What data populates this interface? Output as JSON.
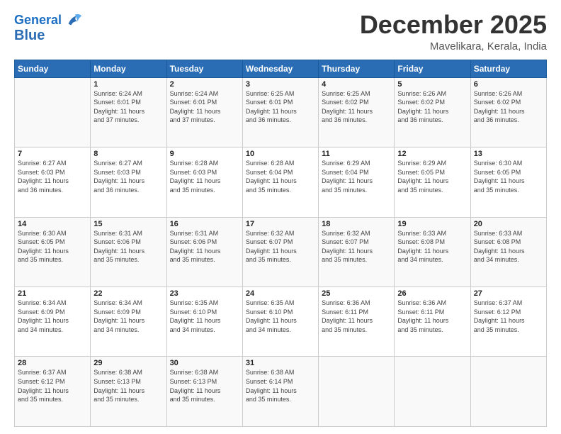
{
  "header": {
    "logo_line1": "General",
    "logo_line2": "Blue",
    "month_title": "December 2025",
    "location": "Mavelikara, Kerala, India"
  },
  "days_of_week": [
    "Sunday",
    "Monday",
    "Tuesday",
    "Wednesday",
    "Thursday",
    "Friday",
    "Saturday"
  ],
  "weeks": [
    [
      {
        "day": "",
        "info": ""
      },
      {
        "day": "1",
        "info": "Sunrise: 6:24 AM\nSunset: 6:01 PM\nDaylight: 11 hours\nand 37 minutes."
      },
      {
        "day": "2",
        "info": "Sunrise: 6:24 AM\nSunset: 6:01 PM\nDaylight: 11 hours\nand 37 minutes."
      },
      {
        "day": "3",
        "info": "Sunrise: 6:25 AM\nSunset: 6:01 PM\nDaylight: 11 hours\nand 36 minutes."
      },
      {
        "day": "4",
        "info": "Sunrise: 6:25 AM\nSunset: 6:02 PM\nDaylight: 11 hours\nand 36 minutes."
      },
      {
        "day": "5",
        "info": "Sunrise: 6:26 AM\nSunset: 6:02 PM\nDaylight: 11 hours\nand 36 minutes."
      },
      {
        "day": "6",
        "info": "Sunrise: 6:26 AM\nSunset: 6:02 PM\nDaylight: 11 hours\nand 36 minutes."
      }
    ],
    [
      {
        "day": "7",
        "info": "Sunrise: 6:27 AM\nSunset: 6:03 PM\nDaylight: 11 hours\nand 36 minutes."
      },
      {
        "day": "8",
        "info": "Sunrise: 6:27 AM\nSunset: 6:03 PM\nDaylight: 11 hours\nand 36 minutes."
      },
      {
        "day": "9",
        "info": "Sunrise: 6:28 AM\nSunset: 6:03 PM\nDaylight: 11 hours\nand 35 minutes."
      },
      {
        "day": "10",
        "info": "Sunrise: 6:28 AM\nSunset: 6:04 PM\nDaylight: 11 hours\nand 35 minutes."
      },
      {
        "day": "11",
        "info": "Sunrise: 6:29 AM\nSunset: 6:04 PM\nDaylight: 11 hours\nand 35 minutes."
      },
      {
        "day": "12",
        "info": "Sunrise: 6:29 AM\nSunset: 6:05 PM\nDaylight: 11 hours\nand 35 minutes."
      },
      {
        "day": "13",
        "info": "Sunrise: 6:30 AM\nSunset: 6:05 PM\nDaylight: 11 hours\nand 35 minutes."
      }
    ],
    [
      {
        "day": "14",
        "info": "Sunrise: 6:30 AM\nSunset: 6:05 PM\nDaylight: 11 hours\nand 35 minutes."
      },
      {
        "day": "15",
        "info": "Sunrise: 6:31 AM\nSunset: 6:06 PM\nDaylight: 11 hours\nand 35 minutes."
      },
      {
        "day": "16",
        "info": "Sunrise: 6:31 AM\nSunset: 6:06 PM\nDaylight: 11 hours\nand 35 minutes."
      },
      {
        "day": "17",
        "info": "Sunrise: 6:32 AM\nSunset: 6:07 PM\nDaylight: 11 hours\nand 35 minutes."
      },
      {
        "day": "18",
        "info": "Sunrise: 6:32 AM\nSunset: 6:07 PM\nDaylight: 11 hours\nand 35 minutes."
      },
      {
        "day": "19",
        "info": "Sunrise: 6:33 AM\nSunset: 6:08 PM\nDaylight: 11 hours\nand 34 minutes."
      },
      {
        "day": "20",
        "info": "Sunrise: 6:33 AM\nSunset: 6:08 PM\nDaylight: 11 hours\nand 34 minutes."
      }
    ],
    [
      {
        "day": "21",
        "info": "Sunrise: 6:34 AM\nSunset: 6:09 PM\nDaylight: 11 hours\nand 34 minutes."
      },
      {
        "day": "22",
        "info": "Sunrise: 6:34 AM\nSunset: 6:09 PM\nDaylight: 11 hours\nand 34 minutes."
      },
      {
        "day": "23",
        "info": "Sunrise: 6:35 AM\nSunset: 6:10 PM\nDaylight: 11 hours\nand 34 minutes."
      },
      {
        "day": "24",
        "info": "Sunrise: 6:35 AM\nSunset: 6:10 PM\nDaylight: 11 hours\nand 34 minutes."
      },
      {
        "day": "25",
        "info": "Sunrise: 6:36 AM\nSunset: 6:11 PM\nDaylight: 11 hours\nand 35 minutes."
      },
      {
        "day": "26",
        "info": "Sunrise: 6:36 AM\nSunset: 6:11 PM\nDaylight: 11 hours\nand 35 minutes."
      },
      {
        "day": "27",
        "info": "Sunrise: 6:37 AM\nSunset: 6:12 PM\nDaylight: 11 hours\nand 35 minutes."
      }
    ],
    [
      {
        "day": "28",
        "info": "Sunrise: 6:37 AM\nSunset: 6:12 PM\nDaylight: 11 hours\nand 35 minutes."
      },
      {
        "day": "29",
        "info": "Sunrise: 6:38 AM\nSunset: 6:13 PM\nDaylight: 11 hours\nand 35 minutes."
      },
      {
        "day": "30",
        "info": "Sunrise: 6:38 AM\nSunset: 6:13 PM\nDaylight: 11 hours\nand 35 minutes."
      },
      {
        "day": "31",
        "info": "Sunrise: 6:38 AM\nSunset: 6:14 PM\nDaylight: 11 hours\nand 35 minutes."
      },
      {
        "day": "",
        "info": ""
      },
      {
        "day": "",
        "info": ""
      },
      {
        "day": "",
        "info": ""
      }
    ]
  ]
}
